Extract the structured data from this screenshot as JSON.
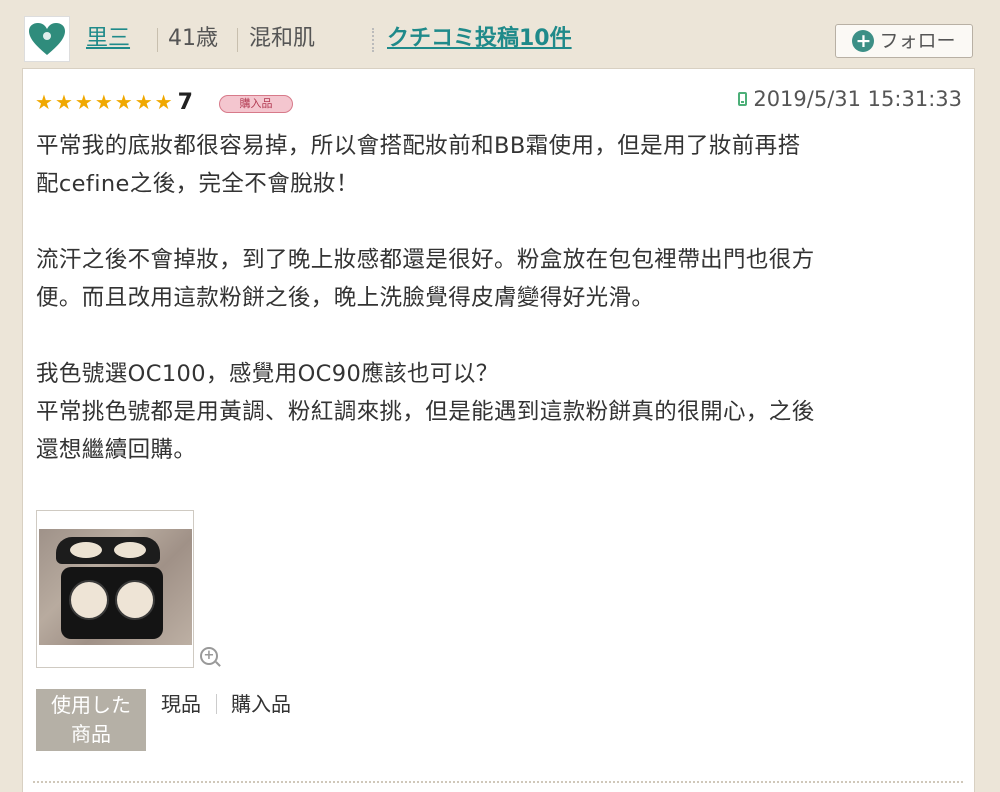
{
  "reviewer": {
    "name": "里三",
    "age": "41歳",
    "skin_type": "混和肌",
    "review_count_link": "クチコミ投稿10件"
  },
  "follow_button": {
    "label": "フォロー",
    "icon": "plus-circle-icon"
  },
  "review": {
    "star_count": 7,
    "star_max": 7,
    "score": "7",
    "badge": "購入品",
    "posted_at": "2019/5/31 15:31:33",
    "paragraphs": [
      "平常我的底妝都很容易掉，所以會搭配妝前和BB霜使用，但是用了妝前再搭\n配cefine之後，完全不會脫妝！",
      "流汗之後不會掉妝，到了晚上妝感都還是很好。粉盒放在包包裡帶出門也很方\n便。而且改用這款粉餅之後，晚上洗臉覺得皮膚變得好光滑。",
      "我色號選OC100，感覺用OC90應該也可以？\n平常挑色號都是用黃調、粉紅調來挑，但是能遇到這款粉餅真的很開心，之後\n還想繼續回購。"
    ],
    "product_label": "使用した\n商品",
    "product_tags": [
      "現品",
      "購入品"
    ]
  },
  "colors": {
    "page_bg": "#ece5d8",
    "link": "#1f8a8a",
    "star": "#f0a800",
    "badge_bg": "#f4c6cf",
    "follow_icon": "#3c8f86"
  }
}
